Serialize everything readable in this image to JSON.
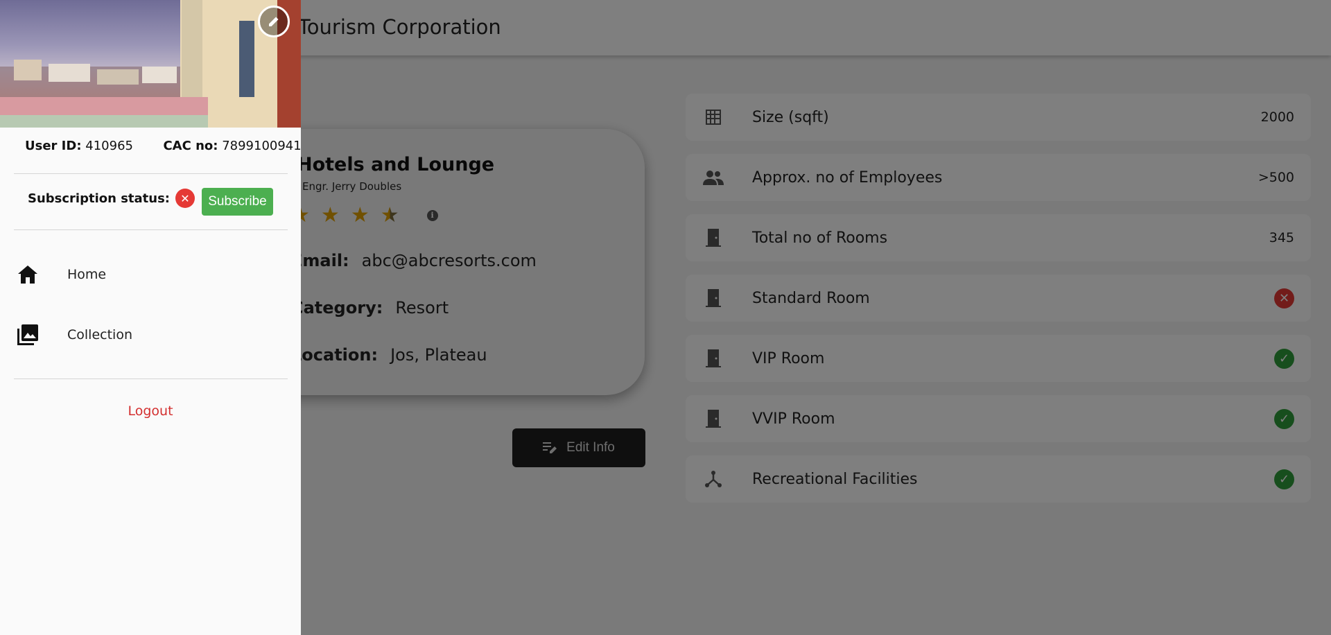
{
  "app": {
    "title": "Tourism Corporation"
  },
  "profile": {
    "name": "Hotels and Lounge",
    "owner": "Engr. Jerry Doubles",
    "rating": 3.5,
    "email_label": "Email:",
    "email": "abc@abcresorts.com",
    "category_label": "Category:",
    "category": "Resort",
    "location_label": "Location:",
    "location": "Jos, Plateau",
    "edit_button": "Edit Info"
  },
  "stats": [
    {
      "icon": "grid-icon",
      "label": "Size (sqft)",
      "value": "2000"
    },
    {
      "icon": "people-icon",
      "label": "Approx. no of Employees",
      "value": ">500"
    },
    {
      "icon": "door-icon",
      "label": "Total no of Rooms",
      "value": "345"
    },
    {
      "icon": "door-icon",
      "label": "Standard Room",
      "status": "unavailable"
    },
    {
      "icon": "door-icon",
      "label": "VIP Room",
      "status": "available"
    },
    {
      "icon": "door-icon",
      "label": "VVIP Room",
      "status": "available"
    },
    {
      "icon": "hub-icon",
      "label": "Recreational Facilities",
      "status": "available"
    }
  ],
  "drawer": {
    "user_id_label": "User ID:",
    "user_id": "410965",
    "cac_label": "CAC no:",
    "cac": "7899100941",
    "subscription_label": "Subscription status:",
    "subscribe_button": "Subscribe",
    "nav": [
      {
        "icon": "home-icon",
        "label": "Home"
      },
      {
        "icon": "collection-icon",
        "label": "Collection"
      }
    ],
    "logout": "Logout"
  },
  "colors": {
    "accent_green": "#4caf50",
    "error_red": "#e53935",
    "logout_red": "#d32f2f",
    "star": "#e0a000"
  }
}
